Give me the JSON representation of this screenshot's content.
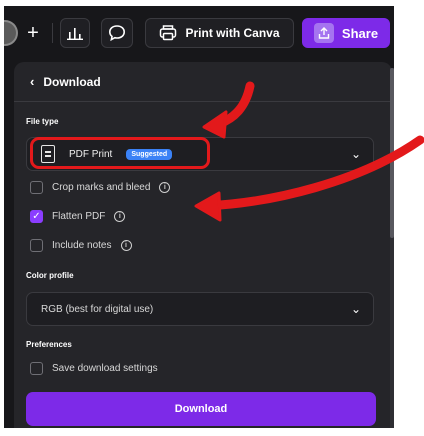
{
  "toolbar": {
    "plus_label": "+",
    "canva_label": "Print with Canva",
    "share_label": "Share"
  },
  "panel": {
    "title": "Download"
  },
  "file_type": {
    "section_label": "File type",
    "selected": "PDF Print",
    "badge": "Suggested"
  },
  "options": [
    {
      "label": "Crop marks and bleed",
      "checked": false
    },
    {
      "label": "Flatten PDF",
      "checked": true
    },
    {
      "label": "Include notes",
      "checked": false
    }
  ],
  "color_profile": {
    "section_label": "Color profile",
    "selected": "RGB (best for digital use)"
  },
  "preferences": {
    "section_label": "Preferences",
    "save_label": "Save download settings",
    "save_checked": false
  },
  "download_label": "Download",
  "colors": {
    "accent": "#7d2ae8",
    "badge": "#3b82f6",
    "annotation": "#e3191b",
    "panel_bg": "#252529"
  },
  "icons": [
    "user-avatar",
    "plus-icon",
    "chart-icon",
    "comment-icon",
    "print-icon",
    "share-icon",
    "pdf-file-icon",
    "chevron-down-icon",
    "info-icon",
    "check-icon",
    "back-chevron-icon"
  ]
}
